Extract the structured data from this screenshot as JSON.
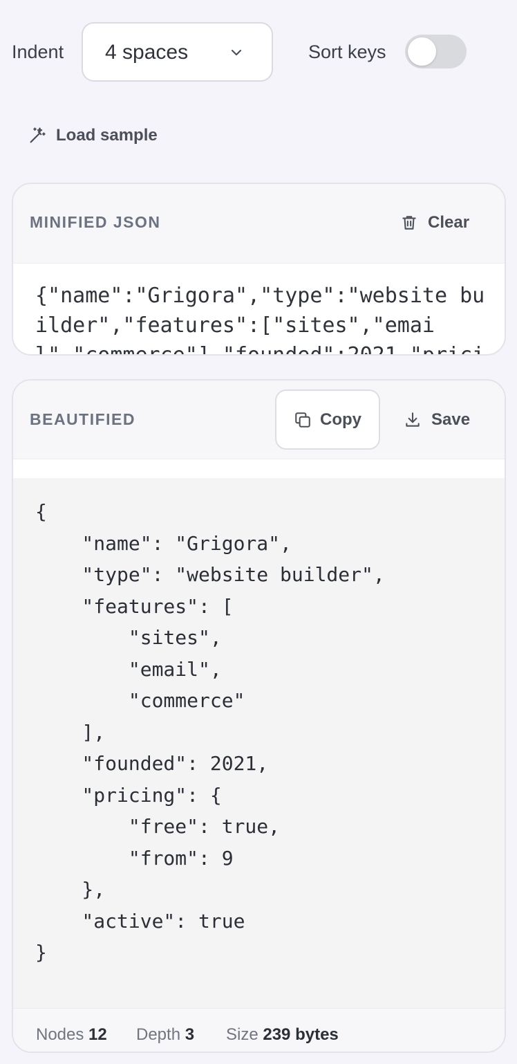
{
  "toolbar": {
    "indent_label": "Indent",
    "indent_value": "4 spaces",
    "sort_keys_label": "Sort keys",
    "sort_keys_on": false,
    "load_sample_label": "Load sample"
  },
  "minified": {
    "title": "MINIFIED JSON",
    "clear_label": "Clear",
    "text": "{\"name\":\"Grigora\",\"type\":\"website builder\",\"features\":[\"sites\",\"email\",\"commerce\"],\"founded\":2021,\"pricing\":{\"free\":true,\"from\":9},\"active\":true}"
  },
  "beautified": {
    "title": "BEAUTIFIED",
    "copy_label": "Copy",
    "save_label": "Save",
    "code": "{\n    \"name\": \"Grigora\",\n    \"type\": \"website builder\",\n    \"features\": [\n        \"sites\",\n        \"email\",\n        \"commerce\"\n    ],\n    \"founded\": 2021,\n    \"pricing\": {\n        \"free\": true,\n        \"from\": 9\n    },\n    \"active\": true\n}"
  },
  "stats": {
    "nodes_label": "Nodes",
    "nodes_value": "12",
    "depth_label": "Depth",
    "depth_value": "3",
    "size_label": "Size",
    "size_value": "239 bytes"
  },
  "icons": {
    "indent_dropdown": "chevron-down-icon",
    "load_sample": "magic-wand-icon",
    "clear": "trash-icon",
    "copy": "copy-icon",
    "save": "download-icon"
  }
}
